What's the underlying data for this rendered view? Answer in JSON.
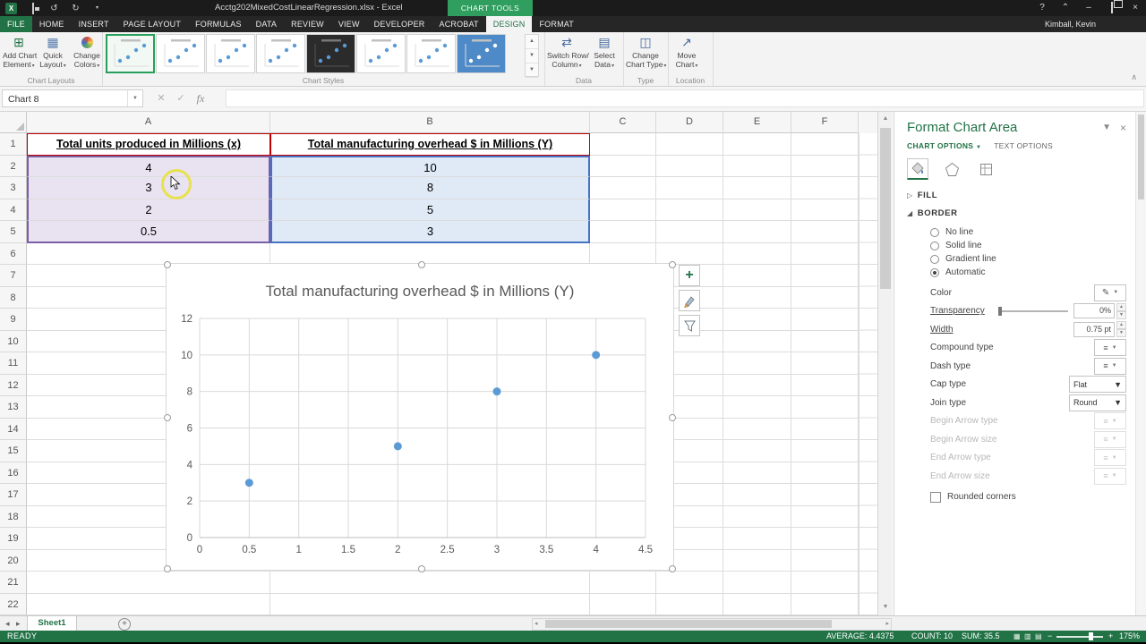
{
  "titlebar": {
    "title": "Acctg202MixedCostLinearRegression.xlsx - Excel",
    "chart_tools": "CHART TOOLS",
    "help": "?",
    "user": "Kimball, Kevin"
  },
  "ribbon": {
    "tabs": [
      "FILE",
      "HOME",
      "INSERT",
      "PAGE LAYOUT",
      "FORMULAS",
      "DATA",
      "REVIEW",
      "VIEW",
      "DEVELOPER",
      "ACROBAT"
    ],
    "contextual_tabs": [
      "DESIGN",
      "FORMAT"
    ],
    "active_tab": "DESIGN",
    "chart_layouts": {
      "label": "Chart Layouts",
      "buttons": [
        {
          "line1": "Add Chart",
          "line2": "Element"
        },
        {
          "line1": "Quick",
          "line2": "Layout"
        },
        {
          "line1": "Change",
          "line2": "Colors"
        }
      ]
    },
    "chart_styles": {
      "label": "Chart Styles"
    },
    "data_group": {
      "label": "Data",
      "buttons": [
        {
          "line1": "Switch Row/",
          "line2": "Column"
        },
        {
          "line1": "Select",
          "line2": "Data"
        }
      ]
    },
    "type_group": {
      "label": "Type",
      "buttons": [
        {
          "line1": "Change",
          "line2": "Chart Type"
        }
      ]
    },
    "location_group": {
      "label": "Location",
      "buttons": [
        {
          "line1": "Move",
          "line2": "Chart"
        }
      ]
    }
  },
  "formula_bar": {
    "name_box": "Chart 8",
    "fx_label": "fx"
  },
  "grid": {
    "column_headers": [
      "A",
      "B",
      "C",
      "D",
      "E",
      "F"
    ],
    "row_count": 22,
    "table": {
      "headers": [
        "Total units produced in Millions (x)",
        "Total manufacturing overhead $ in Millions (Y)"
      ],
      "rows": [
        [
          "4",
          "10"
        ],
        [
          "3",
          "8"
        ],
        [
          "2",
          "5"
        ],
        [
          "0.5",
          "3"
        ]
      ]
    }
  },
  "chart_data": {
    "type": "scatter",
    "title": "Total manufacturing overhead $ in Millions (Y)",
    "x": [
      0.5,
      2,
      3,
      4
    ],
    "y": [
      3,
      5,
      8,
      10
    ],
    "xlim": [
      0,
      4.5
    ],
    "ylim": [
      0,
      12
    ],
    "x_ticks": [
      0,
      0.5,
      1,
      1.5,
      2,
      2.5,
      3,
      3.5,
      4,
      4.5
    ],
    "y_ticks": [
      0,
      2,
      4,
      6,
      8,
      10,
      12
    ],
    "grid": true,
    "legend": false,
    "point_color": "#5b9bd5"
  },
  "format_panel": {
    "title": "Format Chart Area",
    "tabs": [
      "CHART OPTIONS",
      "TEXT OPTIONS"
    ],
    "active_tab": "CHART OPTIONS",
    "fill_section": "FILL",
    "border_section": "BORDER",
    "radios": [
      {
        "label": "No line",
        "checked": false
      },
      {
        "label": "Solid line",
        "checked": false
      },
      {
        "label": "Gradient line",
        "checked": false
      },
      {
        "label": "Automatic",
        "checked": true
      }
    ],
    "fields": [
      {
        "label": "Color",
        "control": "color"
      },
      {
        "label": "Transparency",
        "control": "slider",
        "value": "0%"
      },
      {
        "label": "Width",
        "control": "spinner",
        "value": "0.75 pt"
      },
      {
        "label": "Compound type",
        "control": "dropdown"
      },
      {
        "label": "Dash type",
        "control": "dropdown"
      },
      {
        "label": "Cap type",
        "control": "select",
        "value": "Flat"
      },
      {
        "label": "Join type",
        "control": "select",
        "value": "Round"
      },
      {
        "label": "Begin Arrow type",
        "control": "dropdown",
        "disabled": true
      },
      {
        "label": "Begin Arrow size",
        "control": "dropdown",
        "disabled": true
      },
      {
        "label": "End Arrow type",
        "control": "dropdown",
        "disabled": true
      },
      {
        "label": "End Arrow size",
        "control": "dropdown",
        "disabled": true
      }
    ],
    "rounded_corners": "Rounded corners"
  },
  "sheet_bar": {
    "tabs": [
      "Sheet1"
    ],
    "active": "Sheet1"
  },
  "status_bar": {
    "mode": "READY",
    "average": "AVERAGE: 4.4375",
    "count": "COUNT: 10",
    "sum": "SUM: 35.5",
    "zoom": "175%"
  }
}
